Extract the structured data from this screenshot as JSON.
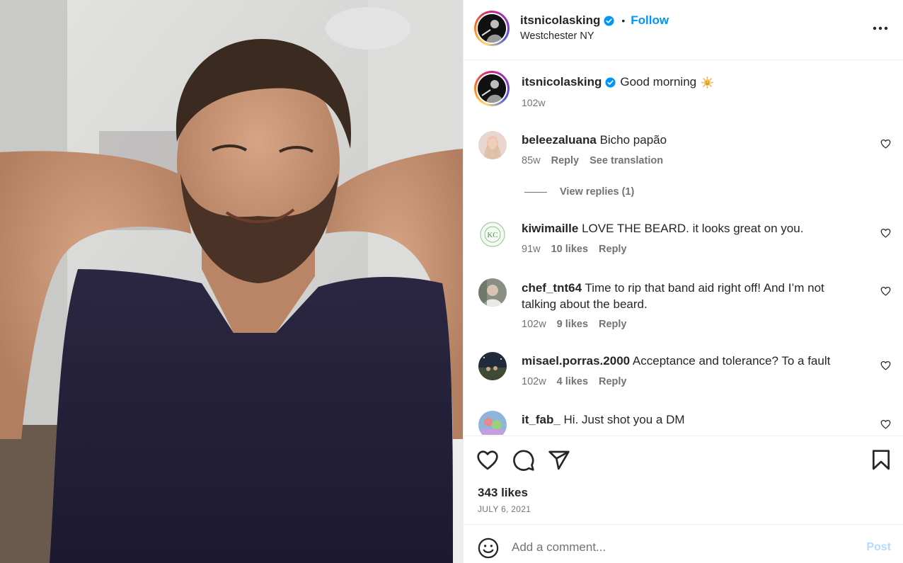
{
  "post": {
    "author": "itsnicolasking",
    "follow_label": "Follow",
    "separator": "•",
    "location": "Westchester NY",
    "more_icon": "more-horizontal-icon"
  },
  "caption": {
    "username": "itsnicolasking",
    "text": "Good morning",
    "emoji": "sun-emoji",
    "age": "102w"
  },
  "comments": [
    {
      "username": "beleezaluana",
      "text": "Bicho papão",
      "age": "85w",
      "likes": "",
      "reply": "Reply",
      "translate": "See translation",
      "view_replies": "View replies (1)"
    },
    {
      "username": "kiwimaille",
      "text": "LOVE THE BEARD. it looks great on you.",
      "age": "91w",
      "likes": "10 likes",
      "reply": "Reply"
    },
    {
      "username": "chef_tnt64",
      "text": "Time to rip that band aid right off! And I’m not talking about the beard.",
      "age": "102w",
      "likes": "9 likes",
      "reply": "Reply"
    },
    {
      "username": "misael.porras.2000",
      "text": "Acceptance and tolerance? To a fault",
      "age": "102w",
      "likes": "4 likes",
      "reply": "Reply"
    },
    {
      "username": "it_fab_",
      "text": "Hi. Just shot you a DM",
      "age": "",
      "likes": "",
      "reply": ""
    }
  ],
  "actions": {
    "icons": [
      "heart-icon",
      "comment-icon",
      "share-icon",
      "bookmark-icon"
    ],
    "likes": "343 likes",
    "date": "JULY 6, 2021"
  },
  "add_comment": {
    "placeholder": "Add a comment...",
    "post_label": "Post"
  },
  "colors": {
    "accent": "#0095f6",
    "text": "#262626",
    "secondary": "#737373",
    "post_disabled": "#b3dbff"
  }
}
